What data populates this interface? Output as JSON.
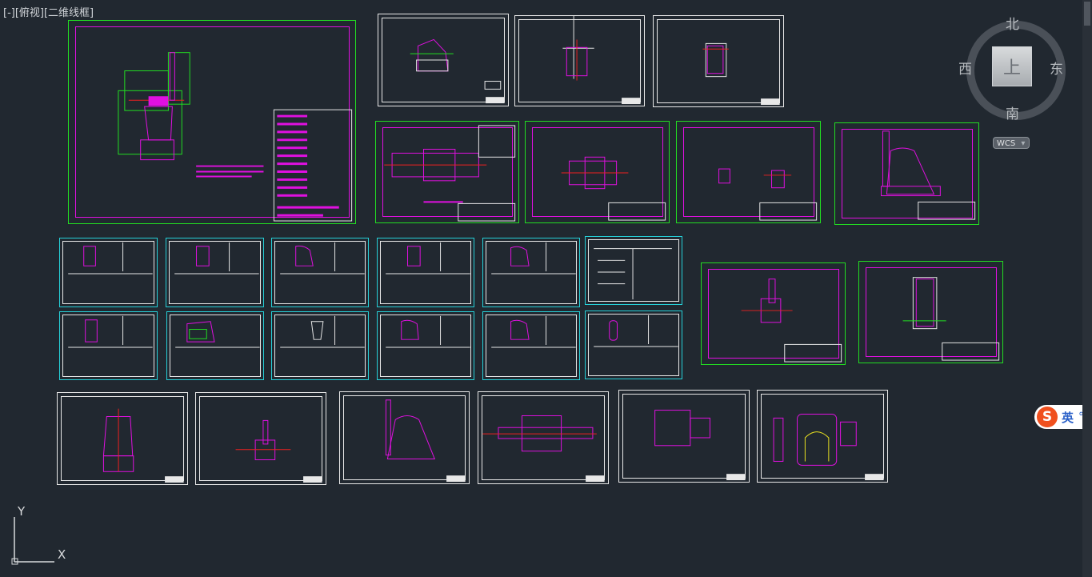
{
  "viewport": {
    "label": "[-][俯视][二维线框]"
  },
  "viewcube": {
    "north": "北",
    "south": "南",
    "east": "东",
    "west": "西",
    "face": "上"
  },
  "wcs": {
    "label": "WCS",
    "arrow": "▾"
  },
  "ucs": {
    "y_label": "Y",
    "x_label": "X"
  },
  "ime": {
    "logo": "S",
    "language": "英",
    "extra": "°,"
  },
  "colors": {
    "background": "#212830",
    "sheet_white": "#e8e8e8",
    "sheet_green": "#22dd22",
    "geometry_magenta": "#e010e0",
    "dimension_green": "#22dd22",
    "table_cyan": "#26d0d8",
    "centerline_red": "#ee2020"
  },
  "icons": {
    "viewcube_face": "viewcube-top-face-icon",
    "ucs": "ucs-axis-icon",
    "ime": "sogou-ime-icon"
  }
}
